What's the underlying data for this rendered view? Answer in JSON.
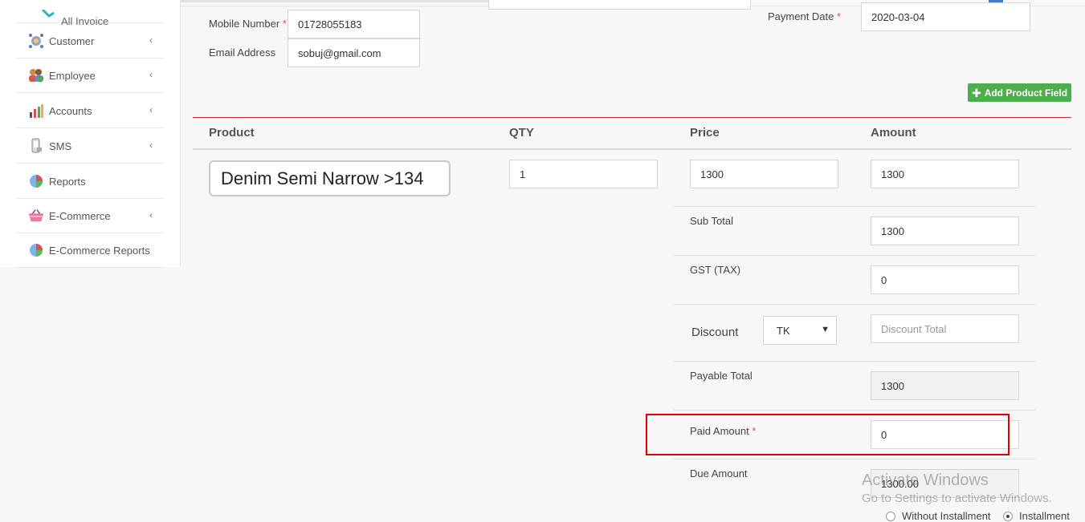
{
  "sidebar": {
    "items": [
      {
        "label": "All Invoice",
        "icon": "all-invoice-icon"
      },
      {
        "label": "Customer",
        "icon": "customer-icon",
        "has_submenu": true
      },
      {
        "label": "Employee",
        "icon": "employee-icon",
        "has_submenu": true
      },
      {
        "label": "Accounts",
        "icon": "accounts-chart-icon",
        "has_submenu": true
      },
      {
        "label": "SMS",
        "icon": "sms-phone-icon",
        "has_submenu": true
      },
      {
        "label": "Reports",
        "icon": "reports-pie-icon"
      },
      {
        "label": "E-Commerce",
        "icon": "ecommerce-basket-icon",
        "has_submenu": true
      },
      {
        "label": "E-Commerce Reports",
        "icon": "ecommerce-reports-pie-icon"
      }
    ],
    "chevron": "‹"
  },
  "customer_info": {
    "mobile_label": "Mobile Number",
    "mobile_value": "01728055183",
    "email_label": "Email Address",
    "email_value": "sobuj@gmail.com",
    "required_mark": "*"
  },
  "payment": {
    "date_label": "Payment Date",
    "date_value": "2020-03-04"
  },
  "add_product_button": "Add Product Field",
  "table": {
    "headers": {
      "product": "Product",
      "qty": "QTY",
      "price": "Price",
      "amount": "Amount"
    },
    "row": {
      "product": "Denim Semi Narrow >134",
      "qty": "1",
      "price": "1300",
      "amount": "1300"
    }
  },
  "totals": {
    "sub_total_label": "Sub Total",
    "sub_total_value": "1300",
    "gst_label": "GST (TAX)",
    "gst_value": "0",
    "discount_label": "Discount",
    "discount_type": "TK",
    "discount_placeholder": "Discount Total",
    "payable_label": "Payable Total",
    "payable_value": "1300",
    "paid_label": "Paid Amount",
    "paid_value": "0",
    "due_label": "Due Amount",
    "due_value": "1300.00"
  },
  "installment": {
    "without_label": "Without Installment",
    "with_label": "Installment",
    "selected": "Installment"
  },
  "watermark": {
    "line1": "Activate Windows",
    "line2": "Go to Settings to activate Windows."
  },
  "colors": {
    "accent_green": "#4cae4c",
    "highlight_red": "#e00000",
    "required_red": "#d9534f"
  }
}
